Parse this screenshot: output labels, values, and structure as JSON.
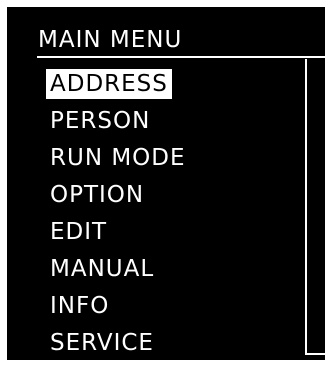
{
  "menu": {
    "title": "MAIN MENU",
    "selected_index": 0,
    "items": [
      {
        "label": "ADDRESS"
      },
      {
        "label": "PERSON"
      },
      {
        "label": "RUN MODE"
      },
      {
        "label": "OPTION"
      },
      {
        "label": "EDIT"
      },
      {
        "label": "MANUAL"
      },
      {
        "label": "INFO"
      },
      {
        "label": "SERVICE"
      }
    ]
  },
  "colors": {
    "background": "#000000",
    "foreground": "#ffffff",
    "highlight_bg": "#ffffff",
    "highlight_fg": "#000000"
  }
}
